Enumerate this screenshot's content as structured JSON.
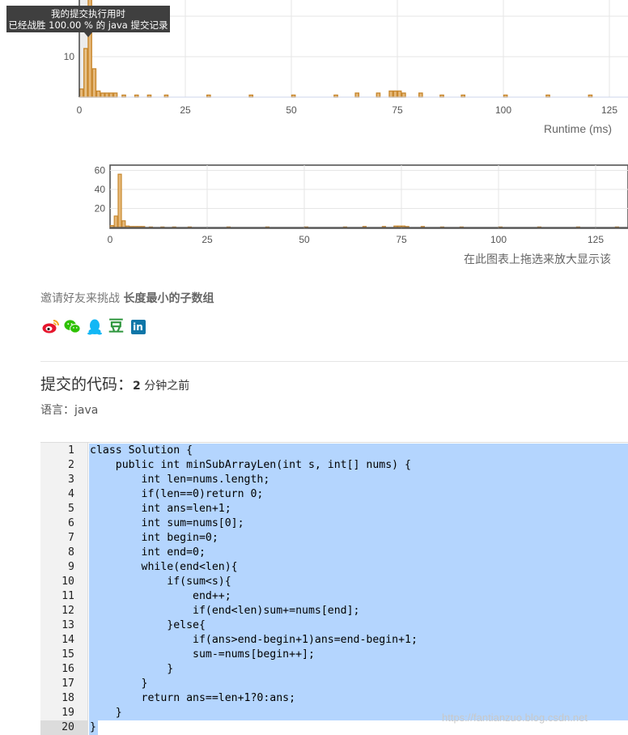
{
  "tooltip": {
    "line1": "我的提交执行用时",
    "line2": "已经战胜 100.00 % 的 java 提交记录"
  },
  "chart_data": [
    {
      "type": "bar",
      "title": "",
      "xlabel": "Runtime (ms)",
      "ylabel": "",
      "xlim": [
        0,
        135
      ],
      "x_ticks": [
        "0",
        "25",
        "50",
        "75",
        "100",
        "125"
      ],
      "y_ticks": [
        "10"
      ],
      "grid": true,
      "bar_color": "#c8882f",
      "highlight_bin": 1,
      "bins": [
        {
          "x": 0,
          "y": 2
        },
        {
          "x": 1,
          "y": 12
        },
        {
          "x": 2,
          "y": 56
        },
        {
          "x": 3,
          "y": 7
        },
        {
          "x": 4,
          "y": 1.5
        },
        {
          "x": 5,
          "y": 1
        },
        {
          "x": 6,
          "y": 1
        },
        {
          "x": 7,
          "y": 1
        },
        {
          "x": 8,
          "y": 1
        },
        {
          "x": 10,
          "y": 0.5
        },
        {
          "x": 13,
          "y": 0.5
        },
        {
          "x": 16,
          "y": 0.5
        },
        {
          "x": 20,
          "y": 0.5
        },
        {
          "x": 30,
          "y": 0.5
        },
        {
          "x": 40,
          "y": 0.5
        },
        {
          "x": 50,
          "y": 0.5
        },
        {
          "x": 60,
          "y": 0.5
        },
        {
          "x": 65,
          "y": 1
        },
        {
          "x": 70,
          "y": 1
        },
        {
          "x": 73,
          "y": 1.5
        },
        {
          "x": 74,
          "y": 1.5
        },
        {
          "x": 75,
          "y": 1.5
        },
        {
          "x": 76,
          "y": 1
        },
        {
          "x": 80,
          "y": 1
        },
        {
          "x": 85,
          "y": 0.5
        },
        {
          "x": 90,
          "y": 0.5
        },
        {
          "x": 100,
          "y": 0.5
        },
        {
          "x": 110,
          "y": 0.5
        },
        {
          "x": 120,
          "y": 0.5
        },
        {
          "x": 130,
          "y": 0.5
        }
      ]
    },
    {
      "type": "bar",
      "title": "",
      "xlabel": "",
      "ylabel": "",
      "xlim": [
        0,
        135
      ],
      "ylim": [
        0,
        70
      ],
      "x_ticks": [
        "0",
        "25",
        "50",
        "75",
        "100",
        "125"
      ],
      "y_ticks": [
        "20",
        "40",
        "60"
      ],
      "grid": true,
      "caption": "在此图表上拖选来放大显示该"
    }
  ],
  "invite": {
    "prefix": "邀请好友来挑战 ",
    "problem": "长度最小的子数组"
  },
  "share": {
    "icons": [
      "weibo-icon",
      "wechat-icon",
      "qq-icon",
      "douban-icon",
      "linkedin-icon"
    ],
    "douban_glyph": "豆",
    "linkedin_glyph": "in"
  },
  "submission": {
    "title": "提交的代码：",
    "ago_num": "2",
    "ago_text": " 分钟之前",
    "language_label": "语言：",
    "language": "java"
  },
  "code": {
    "lines": [
      "class Solution {",
      "    public int minSubArrayLen(int s, int[] nums) {",
      "        int len=nums.length;",
      "        if(len==0)return 0;",
      "        int ans=len+1;",
      "        int sum=nums[0];",
      "        int begin=0;",
      "        int end=0;",
      "        while(end<len){",
      "            if(sum<s){",
      "                end++;",
      "                if(end<len)sum+=nums[end];",
      "            }else{",
      "                if(ans>end-begin+1)ans=end-begin+1;",
      "                sum-=nums[begin++];",
      "            }",
      "        }",
      "        return ans==len+1?0:ans;",
      "    }",
      "}"
    ]
  },
  "watermark": "https://fantianzuo.blog.csdn.net"
}
